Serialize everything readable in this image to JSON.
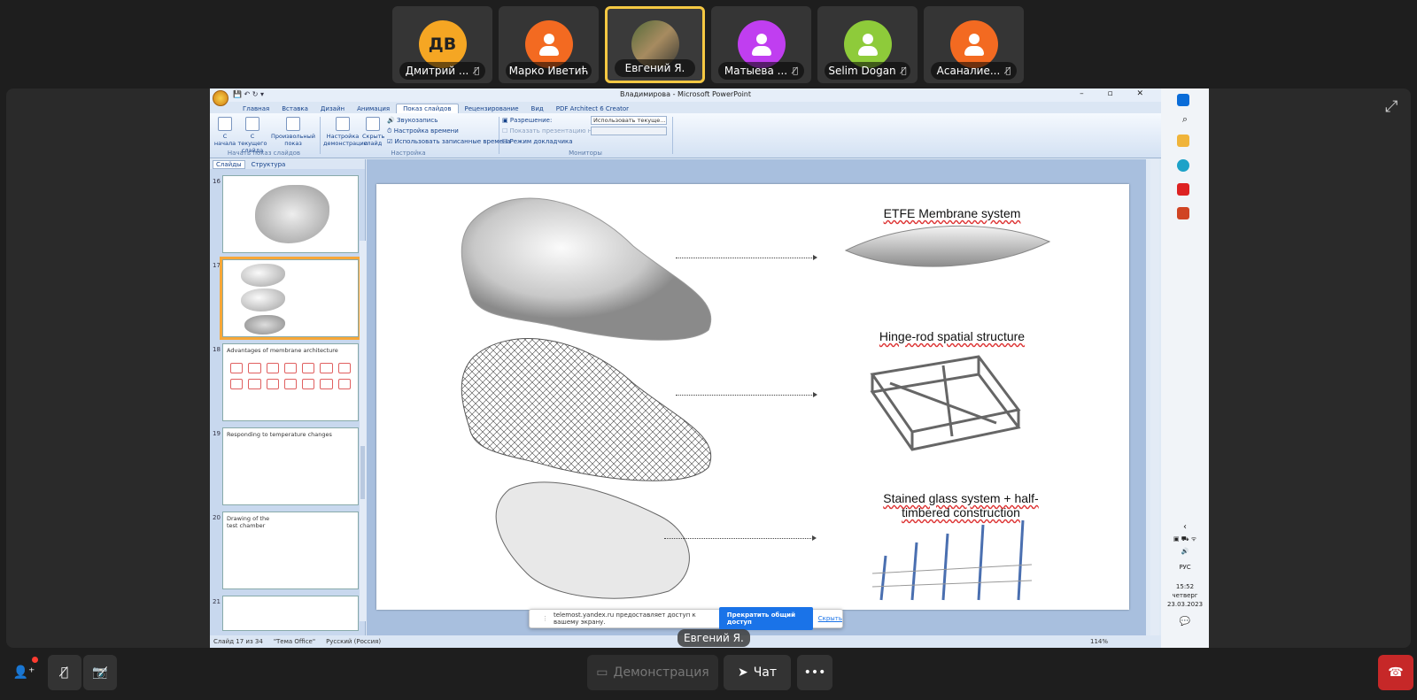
{
  "participants": [
    {
      "initials": "ДВ",
      "name": "Дмитрий ...",
      "color": "#f5a623",
      "muted": true,
      "active": false
    },
    {
      "initials": "",
      "name": "Марко Иветић",
      "color": "#f36a21",
      "muted": false,
      "active": false
    },
    {
      "initials": "",
      "name": "Евгений Я.",
      "color": "",
      "muted": false,
      "active": true
    },
    {
      "initials": "",
      "name": "Матыева ...",
      "color": "#c03ef0",
      "muted": true,
      "active": false
    },
    {
      "initials": "",
      "name": "Selim Dogan",
      "color": "#8ecb3a",
      "muted": true,
      "active": false
    },
    {
      "initials": "",
      "name": "Асаналие...",
      "color": "#f36a21",
      "muted": true,
      "active": false
    }
  ],
  "ppt": {
    "window_title": "Владимирова - Microsoft PowerPoint",
    "tabs": [
      "Главная",
      "Вставка",
      "Дизайн",
      "Анимация",
      "Показ слайдов",
      "Рецензирование",
      "Вид",
      "PDF Architect 6 Creator"
    ],
    "ribbon": {
      "btn_from_start": "С начала",
      "btn_from_current": "С текущего слайда",
      "btn_custom": "Произвольный показ",
      "group_start": "Начать показ слайдов",
      "btn_setup": "Настройка демонстрации",
      "btn_hide": "Скрыть слайд",
      "opt_record": "Звукозапись",
      "opt_timings": "Настройка времени",
      "opt_use_timings": "Использовать записанные времена",
      "group_setup": "Настройка",
      "resolution_label": "Разрешение:",
      "resolution_value": "Использовать текуще...",
      "show_on_label": "Показать презентацию на:",
      "presenter_mode": "Режим докладчика",
      "group_monitors": "Мониторы"
    },
    "panel_tabs": [
      "Слайды",
      "Структура"
    ],
    "thumbs": [
      {
        "num": "16",
        "title": ""
      },
      {
        "num": "17",
        "title": ""
      },
      {
        "num": "18",
        "title": "Advantages of membrane architecture"
      },
      {
        "num": "19",
        "title": "Responding to temperature changes"
      },
      {
        "num": "20",
        "title": "Drawing of the test chamber"
      },
      {
        "num": "21",
        "title": ""
      }
    ],
    "slide": {
      "cap1": "ETFE Membrane  system",
      "cap2": "Hinge-rod spatial structure",
      "cap3": "Stained glass system + half-timbered construction"
    },
    "status": {
      "slide": "Слайд 17 из 34",
      "theme": "\"Тема Office\"",
      "lang": "Русский (Россия)",
      "zoom": "114%"
    }
  },
  "taskbar": {
    "lang": "РУС",
    "time": "15:52",
    "day": "четверг",
    "date": "23.03.2023"
  },
  "share_notice": {
    "text": "telemost.yandex.ru предоставляет доступ к вашему экрану.",
    "stop": "Прекратить общий доступ",
    "hide": "Скрыть"
  },
  "presenter_label": "Евгений Я.",
  "controls": {
    "demo": "Демонстрация",
    "chat": "Чат"
  }
}
